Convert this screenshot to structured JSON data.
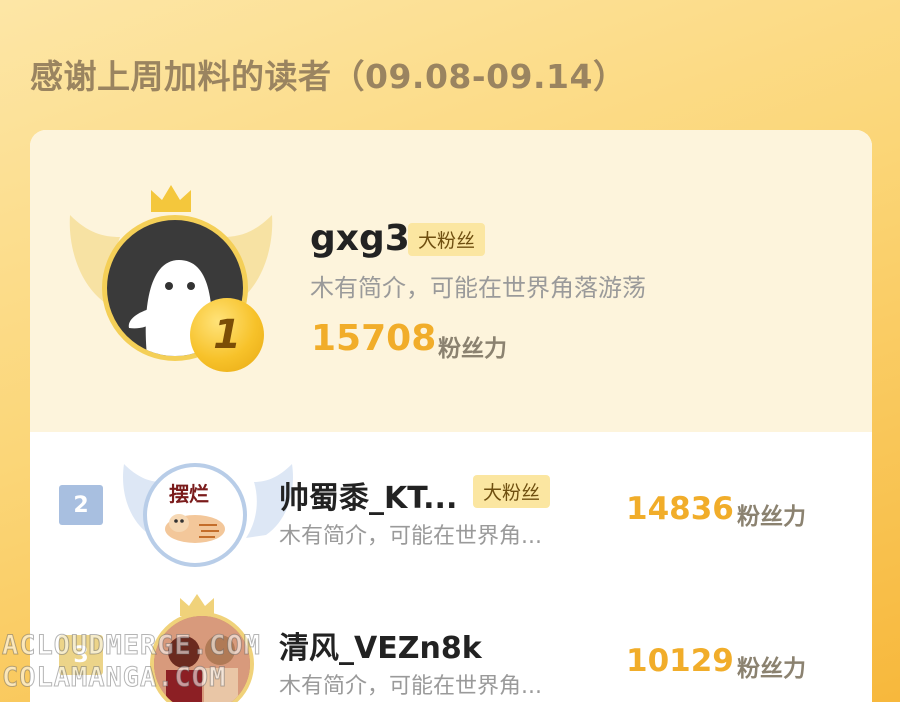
{
  "header": {
    "title": "感谢上周加料的读者（09.08-09.14）"
  },
  "colors": {
    "accent": "#f1ad2a",
    "tag_bg": "#fbe6a1",
    "background": "#fbd678",
    "rank2": "#a8bfe0",
    "rank3": "#ecd489"
  },
  "ranking": [
    {
      "rank": "1",
      "name": "gxg3",
      "badge": "大粉丝",
      "bio": "木有简介，可能在世界角落游荡",
      "score": "15708",
      "unit": "粉丝力",
      "avatar_icon": "ghost-avatar-icon"
    },
    {
      "rank": "2",
      "name": "帅蜀黍_KT...",
      "badge": "大粉丝",
      "bio": "木有简介，可能在世界角...",
      "score": "14836",
      "unit": "粉丝力",
      "avatar_icon": "cat-sticker-avatar-icon",
      "avatar_text": "摆烂"
    },
    {
      "rank": "3",
      "name": "清风_VEZn8k",
      "badge": "",
      "bio": "木有简介，可能在世界角...",
      "score": "10129",
      "unit": "粉丝力",
      "avatar_icon": "photo-avatar-icon"
    }
  ],
  "watermark": {
    "line1": "ACLOUDMERGE.COM",
    "line2": "COLAMANGA.COM"
  }
}
